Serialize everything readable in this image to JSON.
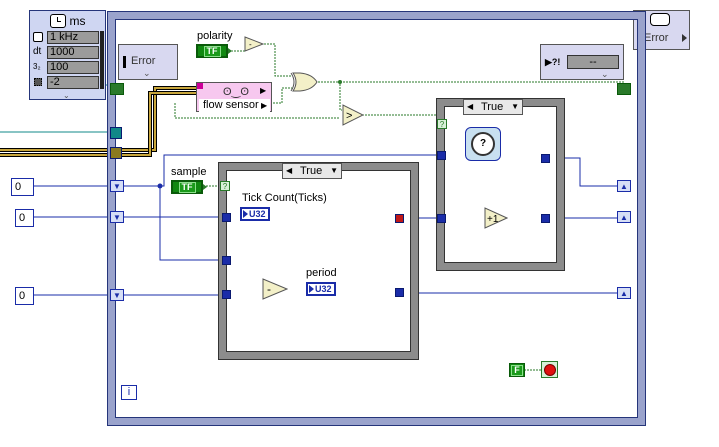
{
  "timer_cluster": {
    "unit": "ms",
    "rows": [
      {
        "label": "1 kHz",
        "icon": "clock-icon"
      },
      {
        "label": "1000",
        "icon": "dt-icon"
      },
      {
        "label": "100",
        "icon": "threshold-icon"
      },
      {
        "label": "-2",
        "icon": "chip-icon"
      }
    ],
    "row_prefixes": [
      "",
      "dt",
      "",
      ""
    ]
  },
  "error_in": {
    "label": "Error"
  },
  "error_out": {
    "label": "Error"
  },
  "status_indicator": {
    "label": "--"
  },
  "polarity": {
    "label": "polarity",
    "value": "TF"
  },
  "flow_sensor": {
    "label": "flow sensor"
  },
  "sample": {
    "label": "sample",
    "value": "TF"
  },
  "case_outer": {
    "selector": "True"
  },
  "case_inner": {
    "selector": "True"
  },
  "tick_count": {
    "label": "Tick Count(Ticks)",
    "type": "U32"
  },
  "period": {
    "label": "period",
    "type": "U32"
  },
  "constants": [
    {
      "value": "0"
    },
    {
      "value": "0"
    },
    {
      "value": "0"
    },
    {
      "value": "0"
    }
  ],
  "stop_constant": {
    "value": "F"
  },
  "iteration_terminal": {
    "label": "i"
  },
  "colors": {
    "loop_frame": "#9aa3cc",
    "wire_blue": "#1a2ca8",
    "wire_green": "#2a7a2a",
    "wire_error": "#c8a63c"
  }
}
